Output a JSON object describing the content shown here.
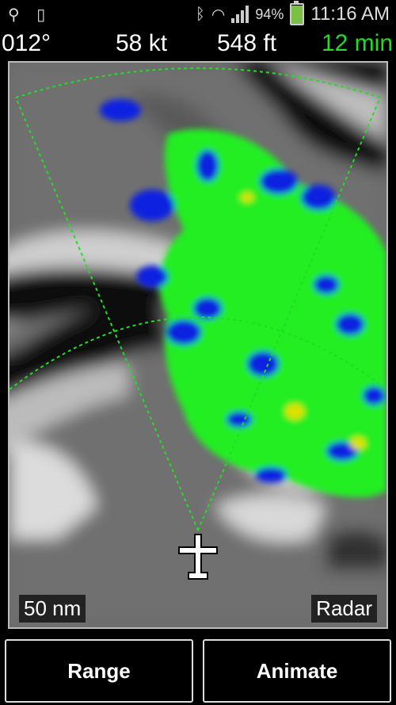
{
  "status_bar": {
    "battery_percent": "94%",
    "battery_level": 0.94,
    "time": "11:16 AM",
    "icons": [
      "usb-icon",
      "phone-icon",
      "bluetooth-icon",
      "wifi-icon",
      "signal-icon",
      "battery-charging-icon"
    ]
  },
  "flight_info": {
    "heading": "012°",
    "speed": "58 kt",
    "altitude": "548 ft",
    "timer": "12 min"
  },
  "radar": {
    "range_label": "50 nm",
    "mode_label": "Radar",
    "colors": {
      "arc": "#22dd22",
      "precip_light": "#1020e0",
      "precip_medium": "#22ee22",
      "precip_heavy": "#e0e000",
      "terrain_dark": "#111111",
      "terrain_light": "#d8d8d8"
    }
  },
  "buttons": {
    "range": "Range",
    "animate": "Animate"
  }
}
